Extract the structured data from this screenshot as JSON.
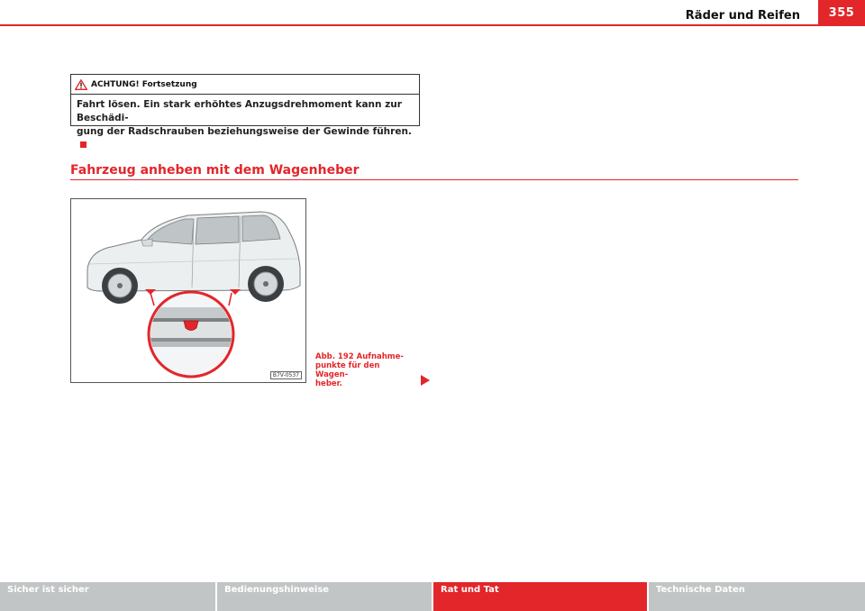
{
  "header": {
    "title": "Räder und Reifen",
    "page_number": "355"
  },
  "warning": {
    "icon": "warning-triangle-icon",
    "title": "ACHTUNG! Fortsetzung",
    "body_line1": "Fahrt lösen. Ein stark erhöhtes Anzugsdrehmoment kann zur Beschädi-",
    "body_line2": "gung der Radschrauben beziehungsweise der Gewinde führen."
  },
  "section": {
    "title": "Fahrzeug anheben mit dem Wagenheber"
  },
  "figure": {
    "code": "B7V-0537",
    "caption_line1": "Abb. 192   Aufnahme-",
    "caption_line2": "punkte für den Wagen-",
    "caption_line3": "heber."
  },
  "footer": {
    "tabs": [
      {
        "label": "Sicher ist sicher",
        "active": false
      },
      {
        "label": "Bedienungshinweise",
        "active": false
      },
      {
        "label": "Rat und Tat",
        "active": true
      },
      {
        "label": "Technische Daten",
        "active": false
      }
    ]
  },
  "colors": {
    "accent": "#e3262a",
    "footer_gray": "#c2c5c6"
  }
}
